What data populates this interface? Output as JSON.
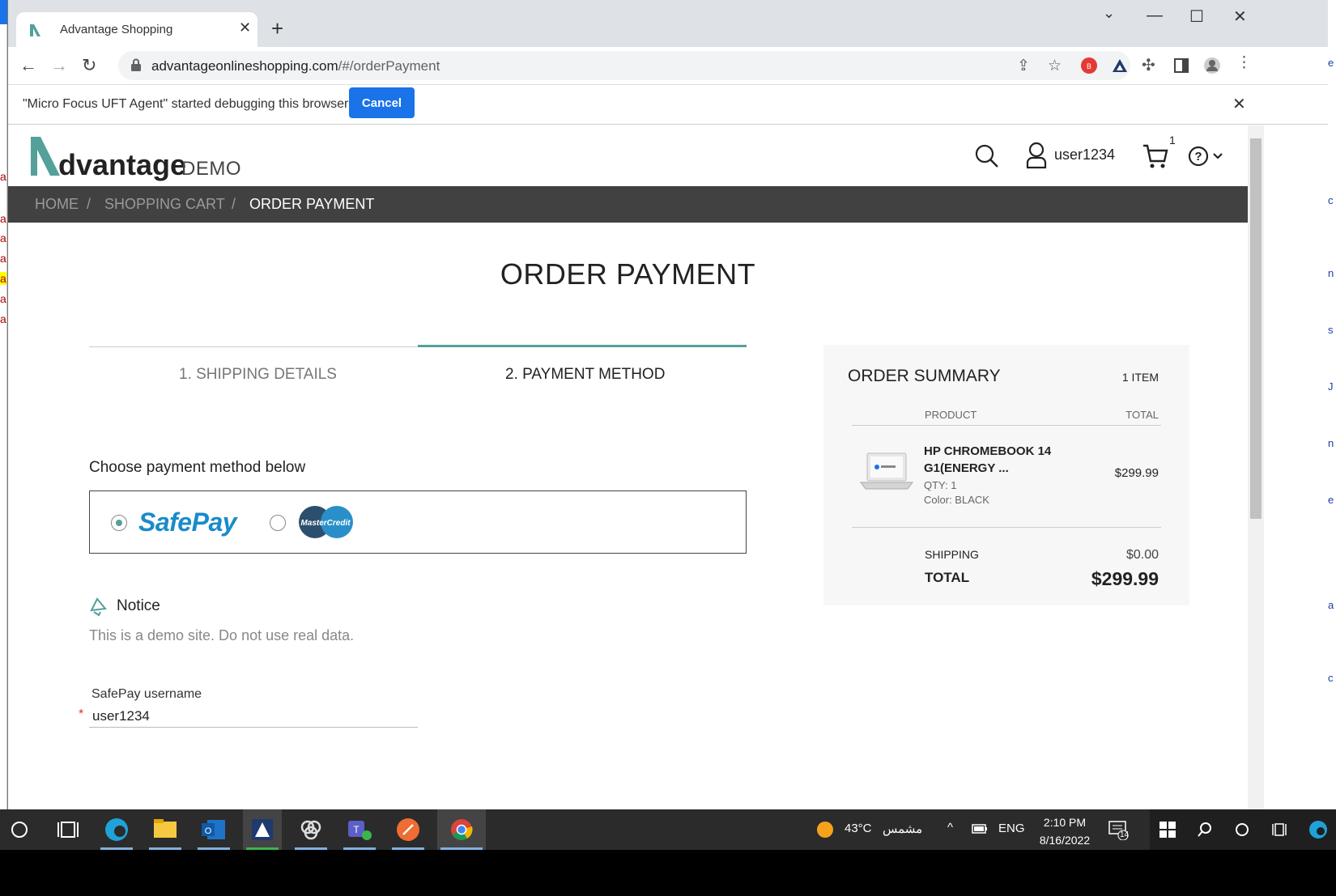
{
  "browser": {
    "tab_title": "Advantage Shopping",
    "url_host": "advantageonlineshopping.com",
    "url_path": "/#/orderPayment"
  },
  "infobar": {
    "message": "\"Micro Focus UFT Agent\" started debugging this browser",
    "cancel_label": "Cancel"
  },
  "site": {
    "logo_text": "dvantage",
    "logo_demo": "DEMO",
    "username": "user1234",
    "cart_count": "1"
  },
  "breadcrumb": {
    "home": "HOME",
    "cart": "SHOPPING CART",
    "current": "ORDER PAYMENT",
    "separator": "/"
  },
  "main": {
    "title": "ORDER PAYMENT",
    "step1": "1. SHIPPING DETAILS",
    "step2": "2. PAYMENT METHOD",
    "choose_label": "Choose payment method below",
    "safepay_label": "SafePay",
    "mastercredit_label": "MasterCredit",
    "selected_method": "SafePay",
    "notice_title": "Notice",
    "notice_text": "This is a demo site. Do not use real data.",
    "username_label": "SafePay username",
    "username_value": "user1234",
    "required_mark": "*"
  },
  "summary": {
    "title": "ORDER SUMMARY",
    "item_count": "1 ITEM",
    "col_product": "PRODUCT",
    "col_total": "TOTAL",
    "product_name": "HP CHROMEBOOK 14 G1(ENERGY ...",
    "qty": "QTY: 1",
    "color": "Color: BLACK",
    "price": "$299.99",
    "shipping_label": "SHIPPING",
    "shipping_value": "$0.00",
    "total_label": "TOTAL",
    "total_value": "$299.99"
  },
  "taskbar": {
    "weather_temp": "43°C",
    "weather_desc": "مشمس",
    "language": "ENG",
    "time": "2:10 PM",
    "date": "8/16/2022",
    "notifications": "14"
  },
  "colors": {
    "accent": "#54a09a",
    "breadcrumb_bg": "#414141",
    "info_button": "#1a73e8"
  }
}
